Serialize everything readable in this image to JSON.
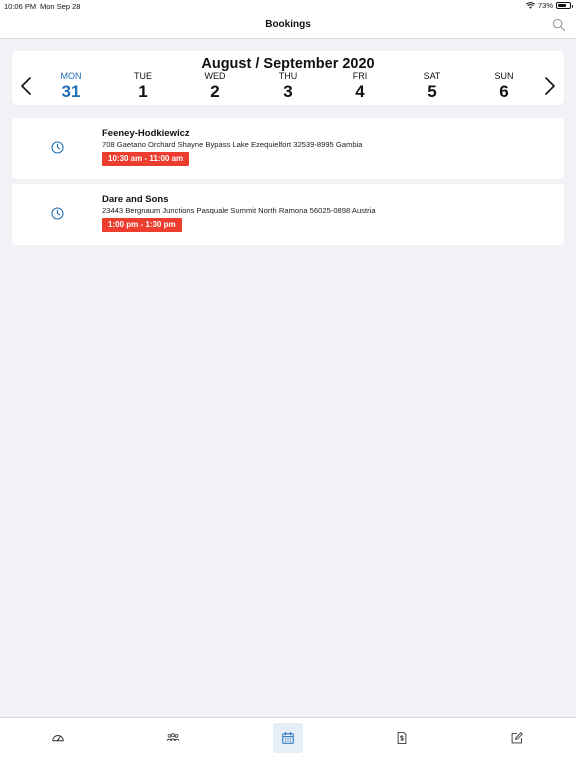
{
  "status_bar": {
    "time": "10:06 PM",
    "date": "Mon Sep 28",
    "battery": "73%",
    "battery_level": 0.73
  },
  "nav": {
    "title": "Bookings",
    "search_icon": "search-icon"
  },
  "calendar": {
    "title": "August / September 2020",
    "prev_icon": "chevron-left-icon",
    "next_icon": "chevron-right-icon",
    "days": [
      {
        "name": "MON",
        "number": "31",
        "selected": true
      },
      {
        "name": "TUE",
        "number": "1",
        "selected": false
      },
      {
        "name": "WED",
        "number": "2",
        "selected": false
      },
      {
        "name": "THU",
        "number": "3",
        "selected": false
      },
      {
        "name": "FRI",
        "number": "4",
        "selected": false
      },
      {
        "name": "SAT",
        "number": "5",
        "selected": false
      },
      {
        "name": "SUN",
        "number": "6",
        "selected": false
      }
    ]
  },
  "bookings": [
    {
      "name": "Feeney-Hodkiewicz",
      "address": "708 Gaetano Orchard Shayne Bypass Lake Ezequielfort 32539-8995 Gambia",
      "time": "10:30 am - 11:00 am",
      "icon": "clock-icon"
    },
    {
      "name": "Dare and Sons",
      "address": "23443 Bergnaum Junctions Pasquale Summit North Ramona 56025-0898 Austria",
      "time": "1:00 pm - 1:30 pm",
      "icon": "clock-icon"
    }
  ],
  "colors": {
    "accent": "#1e6fb5",
    "badge": "#ec3d2f",
    "background": "#f2f2f6"
  },
  "tabs": [
    {
      "icon": "dashboard-gauge-icon",
      "active": false
    },
    {
      "icon": "people-group-icon",
      "active": false
    },
    {
      "icon": "calendar-icon",
      "active": true
    },
    {
      "icon": "invoice-dollar-icon",
      "active": false
    },
    {
      "icon": "edit-note-icon",
      "active": false
    }
  ]
}
